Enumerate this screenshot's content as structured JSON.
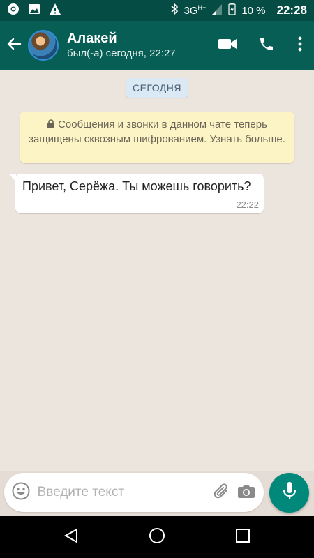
{
  "statusbar": {
    "network": "3G",
    "network_sup": "H+",
    "battery": "10 %",
    "time": "22:28"
  },
  "chat_header": {
    "name": "Алакей",
    "last_seen": "был(-а) сегодня, 22:27"
  },
  "chat": {
    "date_divider": "СЕГОДНЯ",
    "encryption_notice": "Сообщения и звонки в данном чате теперь защищены сквозным шифрованием. Узнать больше.",
    "messages": [
      {
        "text": "Привет, Серёжа. Ты можешь говорить?",
        "time": "22:22",
        "direction": "incoming"
      }
    ]
  },
  "composer": {
    "placeholder": "Введите текст"
  },
  "colors": {
    "header": "#075e54",
    "statusbar": "#054d44",
    "accent": "#00897b",
    "notice_bg": "#fcf4c4",
    "date_chip_bg": "#dbe9f4"
  },
  "icons": [
    "chrome-icon",
    "image-icon",
    "warning-icon",
    "bluetooth-icon",
    "signal-icon",
    "battery-icon",
    "back-arrow-icon",
    "video-call-icon",
    "phone-icon",
    "more-vert-icon",
    "lock-icon",
    "emoji-icon",
    "attach-icon",
    "camera-icon",
    "mic-icon",
    "nav-back-icon",
    "nav-home-icon",
    "nav-recents-icon"
  ]
}
